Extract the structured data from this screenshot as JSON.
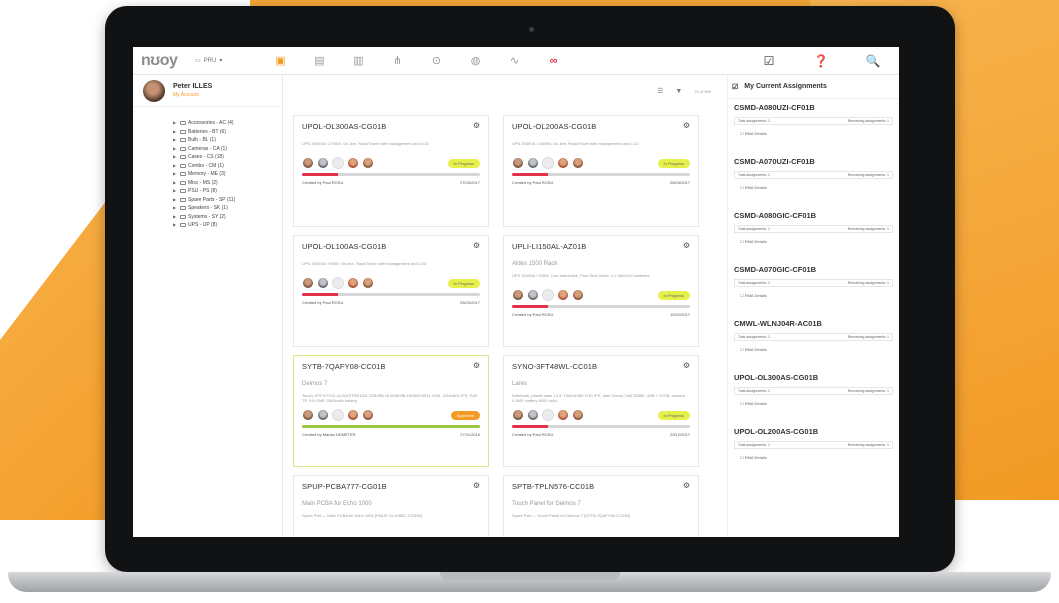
{
  "colors": {
    "accent": "#f39a24",
    "progress_red": "#e0334a",
    "progress_green": "#9bc53d",
    "status_inprogress": "#e6f04a"
  },
  "topbar": {
    "logo": "nʊoy",
    "project": "PRU",
    "nav_icons": [
      "box-icon",
      "grid-icon",
      "columns-icon",
      "tree-icon",
      "pin-icon",
      "globe-icon",
      "activity-icon",
      "chain-icon"
    ],
    "right_icons": [
      "checkbox-icon",
      "help-icon",
      "search-icon"
    ]
  },
  "user": {
    "name": "Peter ILLES",
    "sub": "My Account"
  },
  "tree": [
    "Accessories - AC (4)",
    "Batteries - BT (6)",
    "Bulb - BL (1)",
    "Cameras - CA (1)",
    "Cases - CS (18)",
    "Combo - CM (1)",
    "Memory - ME (3)",
    "Misc - MS (2)",
    "PSU - PS (8)",
    "Spare Parts - SP (11)",
    "Speakers - SK (1)",
    "Systems - SY (2)",
    "UPS - UP (8)"
  ],
  "main": {
    "count": "70 of 999"
  },
  "cards": [
    {
      "title": "UPOL-OL300AS-CG01B",
      "sub": "",
      "desc": "UPS 3000VA / 2700W, On-line, Rack/Tower with management and LCD",
      "status": "In Progress",
      "status_type": "progress",
      "progress": 0.2,
      "progress_color": "#e0334a",
      "creator": "Created by Paul ROSU",
      "date": "27/03/2017"
    },
    {
      "title": "UPOL-OL200AS-CG01B",
      "sub": "",
      "desc": "UPS 2000VA / 1800W, On-line, Rack/Tower with management and LCD",
      "status": "In Progress",
      "status_type": "progress",
      "progress": 0.2,
      "progress_color": "#e0334a",
      "creator": "Created by Paul ROSU",
      "date": "26/03/2017"
    },
    {
      "title": "UPOL-OL100AS-CG01B",
      "sub": "",
      "desc": "UPS 1000VA / 900W, On-line, Rack/Tower with management and LCD",
      "status": "In Progress",
      "status_type": "progress",
      "progress": 0.2,
      "progress_color": "#e0334a",
      "creator": "Created by Paul ROSU",
      "date": "26/03/2017"
    },
    {
      "title": "UPLI-LI150AL-AZ01B",
      "sub": "Aldes 1500 Rack",
      "desc": "UPS 1500VA / 900W, Line-interactive, Pure Sine Wave, 2 x 9Ah/12V batteries",
      "status": "In Progress",
      "status_type": "progress",
      "progress": 0.2,
      "progress_color": "#e0334a",
      "creator": "Created by Paul ROSU",
      "date": "10/02/2017"
    },
    {
      "title": "SYTB-7QAFY08-CC01B",
      "sub": "Deimos 7",
      "desc": "Touch, RTFX/7010-41-B1/STRB1115 2GB/9BL16 8GB/9BL16/0601/9011-4GB, 1024x600 IPS, PoE, TP, 5.5+2MP, 2500mAh battery",
      "status": "Approved",
      "status_type": "approved",
      "progress": 1.0,
      "progress_color": "#9bc53d",
      "creator": "Created by Marian DEMETER",
      "date": "27/11/2016"
    },
    {
      "title": "SYNO-3FT48WL-CC01B",
      "sub": "Lares",
      "desc": "Notebook, plastic case 13.3\" 1366x1080 FHD IPS, Intel Cherry Trail Z8350, 4GB + 32GB, camera 0.3MP, battery 8000 mAh,",
      "status": "In Progress",
      "status_type": "progress",
      "progress": 0.2,
      "progress_color": "#e0334a",
      "creator": "Created by Paul ROSU",
      "date": "29/12/2017"
    },
    {
      "title": "SPUP-PCBA777-CG01B",
      "sub": "Main PCBA for Echo 1000",
      "desc": "Spare Part — Main PCBA for Echo 1000 [PMUP-OL100BC-CG01B]",
      "status": "",
      "status_type": "none",
      "progress": 0,
      "progress_color": "#e0334a",
      "creator": "",
      "date": ""
    },
    {
      "title": "SPTB-TPLN576-CC01B",
      "sub": "Touch Panel for Deimos 7",
      "desc": "Spare Part — Touch Panel for Deimos 7 [SYTB-7QAFY08-CC01B]",
      "status": "",
      "status_type": "none",
      "progress": 0,
      "progress_color": "#e0334a",
      "creator": "",
      "date": ""
    }
  ],
  "assign": {
    "title": "My Current Assignments",
    "total_label": "Total assignments: 1",
    "remaining_label": "Remaining assignments: 1",
    "rma_label": "RMA Details",
    "items": [
      {
        "code": "CSMD-A080UZI-CF01B"
      },
      {
        "code": "CSMD-A070UZI-CF01B"
      },
      {
        "code": "CSMD-A080GIC-CF01B"
      },
      {
        "code": "CSMD-A070GIC-CF01B"
      },
      {
        "code": "CMWL-WLNJ04R-AC01B"
      },
      {
        "code": "UPOL-OL300AS-CG01B"
      },
      {
        "code": "UPOL-OL200AS-CG01B"
      }
    ]
  }
}
